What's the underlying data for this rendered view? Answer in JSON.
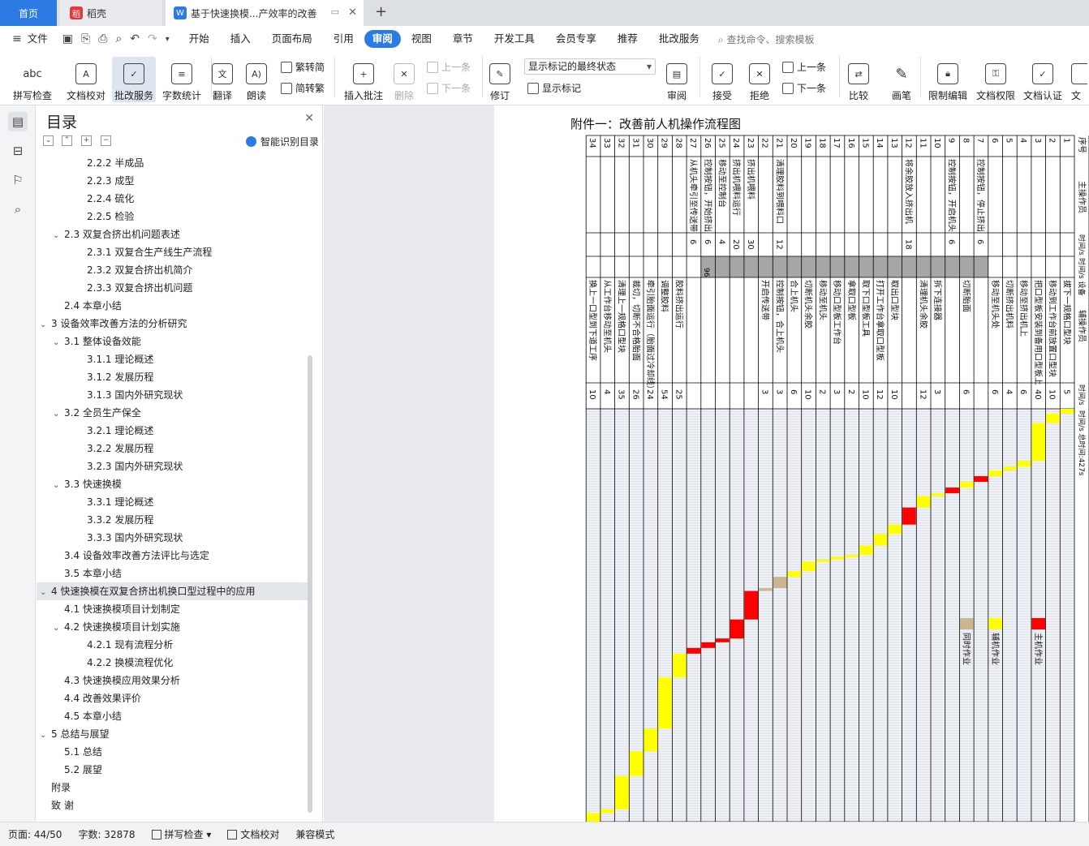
{
  "tabs": {
    "home": "首页",
    "daoke": "稻壳",
    "doc": "基于快速换模...产效率的改善"
  },
  "menu": {
    "file": "文件",
    "items": [
      "开始",
      "插入",
      "页面布局",
      "引用",
      "审阅",
      "视图",
      "章节",
      "开发工具",
      "会员专享",
      "推荐",
      "批改服务"
    ],
    "active": "审阅",
    "search": "查找命令、搜索模板"
  },
  "ribbon": {
    "spell": "拼写检查",
    "proof": "文档校对",
    "correct": "批改服务",
    "count": "字数统计",
    "translate": "翻译",
    "read": "朗读",
    "t2s": "繁转简",
    "s2t": "简转繁",
    "addcomment": "插入批注",
    "delete": "删除",
    "prev": "上一条",
    "next": "下一条",
    "track": "修订",
    "markup_state": "显示标记的最终状态",
    "show_markup": "显示标记",
    "review": "审阅",
    "accept": "接受",
    "reject": "拒绝",
    "prev2": "上一条",
    "next2": "下一条",
    "compare": "比较",
    "pen": "画笔",
    "restrict": "限制编辑",
    "perm": "文档权限",
    "cert": "文档认证",
    "more": "文"
  },
  "toc": {
    "title": "目录",
    "smart": "智能识别目录",
    "items": [
      {
        "t": "2.2.2  半成品",
        "l": 3
      },
      {
        "t": "2.2.3  成型",
        "l": 3
      },
      {
        "t": "2.2.4  硫化",
        "l": 3
      },
      {
        "t": "2.2.5  检验",
        "l": 3
      },
      {
        "t": "2.3  双复合挤出机问题表述",
        "l": 2,
        "c": 1
      },
      {
        "t": "2.3.1  双复合生产线生产流程",
        "l": 3
      },
      {
        "t": "2.3.2  双复合挤出机简介",
        "l": 3
      },
      {
        "t": "2.3.3  双复合挤出机问题",
        "l": 3
      },
      {
        "t": "2.4  本章小结",
        "l": 2
      },
      {
        "t": "3  设备效率改善方法的分析研究",
        "l": 1,
        "c": 1
      },
      {
        "t": "3.1  整体设备效能",
        "l": 2,
        "c": 1
      },
      {
        "t": "3.1.1  理论概述",
        "l": 3
      },
      {
        "t": "3.1.2  发展历程",
        "l": 3
      },
      {
        "t": "3.1.3  国内外研究现状",
        "l": 3
      },
      {
        "t": "3.2  全员生产保全",
        "l": 2,
        "c": 1
      },
      {
        "t": "3.2.1  理论概述",
        "l": 3
      },
      {
        "t": "3.2.2  发展历程",
        "l": 3
      },
      {
        "t": "3.2.3  国内外研究现状",
        "l": 3
      },
      {
        "t": "3.3  快速换模",
        "l": 2,
        "c": 1
      },
      {
        "t": "3.3.1  理论概述",
        "l": 3
      },
      {
        "t": "3.3.2  发展历程",
        "l": 3
      },
      {
        "t": "3.3.3  国内外研究现状",
        "l": 3
      },
      {
        "t": "3.4  设备效率改善方法评比与选定",
        "l": 2
      },
      {
        "t": "3.5  本章小结",
        "l": 2
      },
      {
        "t": "4  快速换模在双复合挤出机换口型过程中的应用",
        "l": 1,
        "c": 1,
        "sel": 1
      },
      {
        "t": "4.1  快速换模项目计划制定",
        "l": 2
      },
      {
        "t": "4.2  快速换模项目计划实施",
        "l": 2,
        "c": 1
      },
      {
        "t": "4.2.1  现有流程分析",
        "l": 3
      },
      {
        "t": "4.2.2  换模流程优化",
        "l": 3
      },
      {
        "t": "4.3  快速换模应用效果分析",
        "l": 2
      },
      {
        "t": "4.4  改善效果评价",
        "l": 2
      },
      {
        "t": "4.5  本章小结",
        "l": 2
      },
      {
        "t": "5  总结与展望",
        "l": 1,
        "c": 1
      },
      {
        "t": "5.1  总结",
        "l": 2
      },
      {
        "t": "5.2  展望",
        "l": 2
      },
      {
        "t": "附录",
        "l": 1
      },
      {
        "t": "致    谢",
        "l": 1
      }
    ]
  },
  "doc": {
    "title": "附件一：改善前人机操作流程图"
  },
  "table": {
    "hdr": {
      "seq": "序号",
      "main": "主操作员",
      "mtime": "时间/s",
      "equip": "时间/s 设备",
      "aux": "辅操作员",
      "atime": "时间/s",
      "total": "时间/s 总时间:427s",
      "equip_val": "96"
    },
    "rows": [
      {
        "n": "1",
        "m": "",
        "mt": "",
        "a": "拔下一规格口型块",
        "at": "5"
      },
      {
        "n": "2",
        "m": "",
        "mt": "",
        "a": "移动到工作台前放置口型块",
        "at": "10"
      },
      {
        "n": "3",
        "m": "",
        "mt": "",
        "a": "把口型板安装到备用口型板上",
        "at": "40"
      },
      {
        "n": "4",
        "m": "",
        "mt": "",
        "a": "移动至挤出机上",
        "at": "6"
      },
      {
        "n": "5",
        "m": "",
        "mt": "",
        "a": "切断挤出机料",
        "at": "4"
      },
      {
        "n": "6",
        "m": "",
        "mt": "",
        "a": "移动至机头处",
        "at": "6"
      },
      {
        "n": "7",
        "m": "控制按钮，停止挤出",
        "mt": "6",
        "a": "",
        "at": ""
      },
      {
        "n": "8",
        "m": "",
        "mt": "",
        "a": "切断胎面",
        "at": "6"
      },
      {
        "n": "9",
        "m": "控制按钮，开启机头",
        "mt": "6",
        "a": "",
        "at": ""
      },
      {
        "n": "10",
        "m": "",
        "mt": "",
        "a": "拆下连接器",
        "at": "3"
      },
      {
        "n": "11",
        "m": "",
        "mt": "",
        "a": "清理机头余胶",
        "at": "12"
      },
      {
        "n": "12",
        "m": "将余胶放入挤出机",
        "mt": "18",
        "a": "",
        "at": ""
      },
      {
        "n": "13",
        "m": "",
        "mt": "",
        "a": "取出口型块",
        "at": "10"
      },
      {
        "n": "14",
        "m": "",
        "mt": "",
        "a": "打开工作台拿取口型板",
        "at": "12"
      },
      {
        "n": "15",
        "m": "",
        "mt": "",
        "a": "取下口型板工具",
        "at": "10"
      },
      {
        "n": "16",
        "m": "",
        "mt": "",
        "a": "拿取口型板",
        "at": "2"
      },
      {
        "n": "17",
        "m": "",
        "mt": "",
        "a": "移动口型板工作台",
        "at": "3"
      },
      {
        "n": "18",
        "m": "",
        "mt": "",
        "a": "移动至机头",
        "at": "2"
      },
      {
        "n": "19",
        "m": "",
        "mt": "",
        "a": "切断机头余胶",
        "at": "10"
      },
      {
        "n": "20",
        "m": "",
        "mt": "",
        "a": "合上机头",
        "at": "6"
      },
      {
        "n": "21",
        "m": "清理胶料到喂料口",
        "mt": "12",
        "a": "控制按钮，合上机头",
        "at": "3"
      },
      {
        "n": "22",
        "m": "",
        "mt": "",
        "a": "开启传送带",
        "at": "3"
      },
      {
        "n": "23",
        "m": "挤出机喂料",
        "mt": "30",
        "a": "",
        "at": ""
      },
      {
        "n": "24",
        "m": "挤出机喂料运行",
        "mt": "20",
        "a": "",
        "at": ""
      },
      {
        "n": "25",
        "m": "移动至控制台",
        "mt": "4",
        "a": "",
        "at": ""
      },
      {
        "n": "26",
        "m": "控制按钮，开始挤出",
        "mt": "6",
        "a": "",
        "at": ""
      },
      {
        "n": "27",
        "m": "从机头牵引至传送带",
        "mt": "6",
        "a": "",
        "at": ""
      },
      {
        "n": "28",
        "m": "",
        "mt": "",
        "a": "胶料挤出运行",
        "at": "25"
      },
      {
        "n": "29",
        "m": "",
        "mt": "",
        "a": "调整胶料",
        "at": "54"
      },
      {
        "n": "30",
        "m": "",
        "mt": "",
        "a": "牵引胎面运行（胎面过冷却线）",
        "at": "24"
      },
      {
        "n": "31",
        "m": "",
        "mt": "",
        "a": "裁切，切断不合格胎面",
        "at": "26"
      },
      {
        "n": "32",
        "m": "",
        "mt": "",
        "a": "清理上一规格口型块",
        "at": "35"
      },
      {
        "n": "33",
        "m": "",
        "mt": "",
        "a": "从工作台移动至机头",
        "at": "4"
      },
      {
        "n": "34",
        "m": "",
        "mt": "",
        "a": "换上一口型到下道工序",
        "at": "10"
      }
    ],
    "legend": [
      {
        "label": "主机作业",
        "color": "#ff0000"
      },
      {
        "label": "辅机作业",
        "color": "#ffff00"
      },
      {
        "label": "同时作业",
        "color": "#c9b88f"
      }
    ]
  },
  "status": {
    "page": "页面: 44/50",
    "words": "字数: 32878",
    "spell": "拼写检查",
    "proof": "文档校对",
    "compat": "兼容模式"
  }
}
